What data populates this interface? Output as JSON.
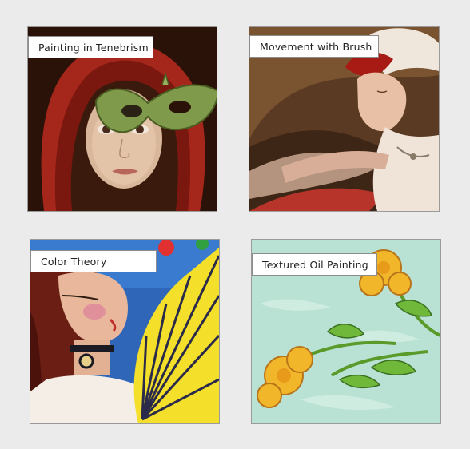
{
  "gallery": {
    "items": [
      {
        "title": "Painting in Tenebrism"
      },
      {
        "title": "Movement with Brush"
      },
      {
        "title": "Color Theory"
      },
      {
        "title": "Textured Oil Painting"
      }
    ]
  }
}
